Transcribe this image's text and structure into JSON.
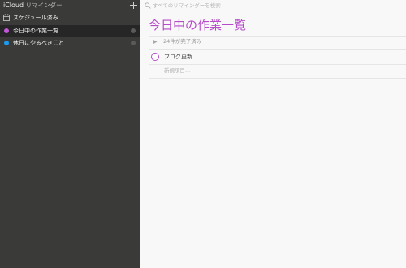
{
  "sidebar": {
    "account_name": "iCloud",
    "account_subtitle": "リマインダー",
    "items": [
      {
        "label": "スケジュール済み"
      },
      {
        "label": "今日中の作業一覧",
        "color": "#c357d9"
      },
      {
        "label": "休日にやるべきこと",
        "color": "#1a9bf0"
      }
    ]
  },
  "search": {
    "placeholder": "すべてのリマインダーを検索"
  },
  "list": {
    "title": "今日中の作業一覧",
    "accent_color": "#b54cc8",
    "completed_summary": "24件が完了済み",
    "tasks": [
      {
        "title": "ブログ更新"
      }
    ],
    "new_item_placeholder": "新規項目..."
  }
}
